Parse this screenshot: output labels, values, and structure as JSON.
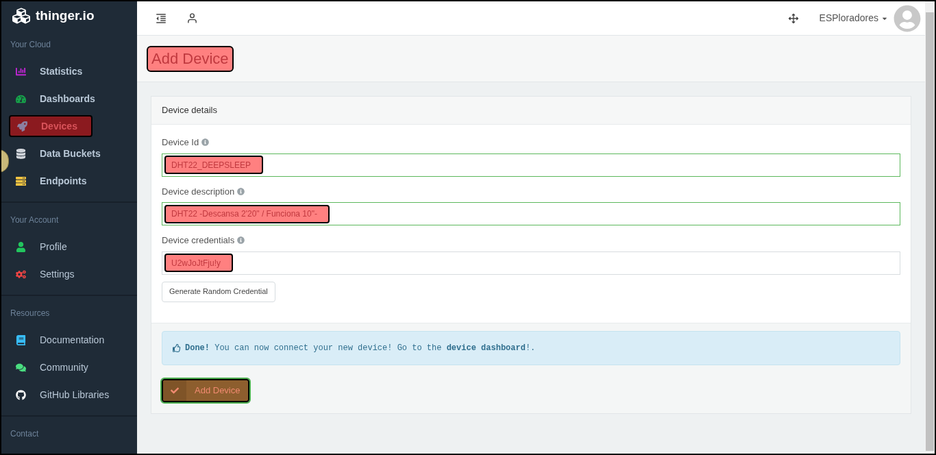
{
  "brand": "thinger.io",
  "sidebar": {
    "sections": [
      {
        "title": "Your Cloud",
        "items": [
          {
            "label": "Statistics",
            "kind": "chart",
            "color": "#c026d3",
            "selected": false
          },
          {
            "label": "Dashboards",
            "kind": "gauge",
            "color": "#16a34a",
            "selected": false
          },
          {
            "label": "Devices",
            "kind": "rocket",
            "color": "#8b7fa0",
            "selected": true
          },
          {
            "label": "Data Buckets",
            "kind": "database",
            "color": "#d1d5db",
            "selected": false
          },
          {
            "label": "Endpoints",
            "kind": "server",
            "color": "#f5c542",
            "selected": false
          }
        ]
      },
      {
        "title": "Your Account",
        "items": [
          {
            "label": "Profile",
            "kind": "user",
            "color": "#22c55e",
            "selected": false
          },
          {
            "label": "Settings",
            "kind": "cogs",
            "color": "#ef4444",
            "selected": false
          }
        ]
      },
      {
        "title": "Resources",
        "items": [
          {
            "label": "Documentation",
            "kind": "book",
            "color": "#38bdf8",
            "selected": false
          },
          {
            "label": "Community",
            "kind": "comments",
            "color": "#4ade80",
            "selected": false
          },
          {
            "label": "GitHub Libraries",
            "kind": "github",
            "color": "#ffffff",
            "selected": false
          }
        ]
      },
      {
        "title": "Contact"
      }
    ]
  },
  "header": {
    "user": "ESPloradores"
  },
  "page_title": "Add Device",
  "card": {
    "title": "Device details",
    "fields": [
      {
        "label": "Device Id",
        "value": "DHT22_DEEPSLEEP",
        "valid": true
      },
      {
        "label": "Device description",
        "value": "DHT22 -Descansa 2'20\" / Funciona 10\"-",
        "valid": true
      },
      {
        "label": "Device credentials",
        "value": "U2wJoJtFju!y",
        "valid": false
      }
    ],
    "generate_button": "Generate Random Credential",
    "alert": "**Done!** You can now connect your new device! Go to the **device dashboard**!.",
    "submit_button": "Add Device"
  }
}
